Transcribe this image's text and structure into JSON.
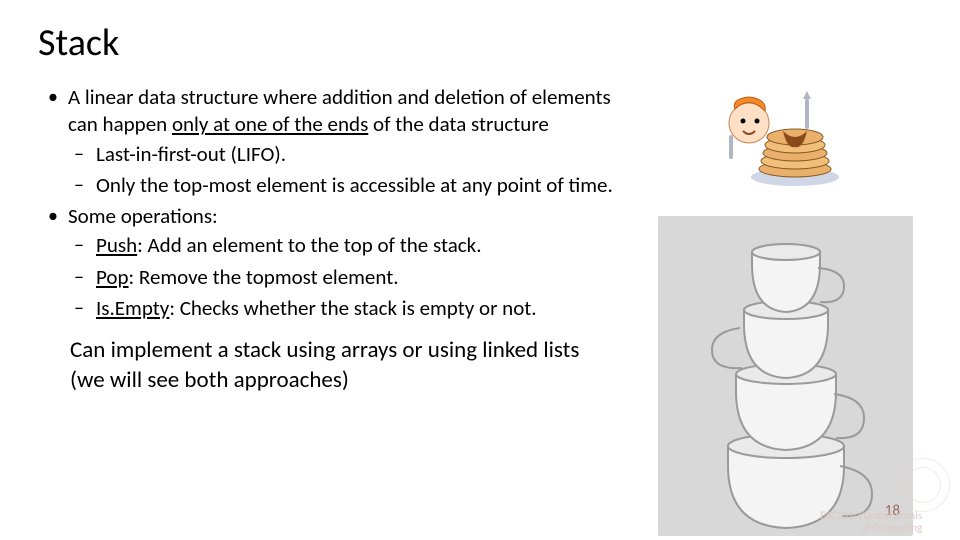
{
  "title": "Stack",
  "bullets": {
    "b1_pre": "A linear data structure where addition and deletion of elements can happen ",
    "b1_u": "only at one of the ends",
    "b1_post": " of the data structure",
    "b1s1": " Last-in-first-out (LIFO).",
    "b1s2": "Only the top-most element is accessible at any point of time.",
    "b2": "Some operations:",
    "b2s1_u": "Push",
    "b2s1_post": ": Add an element to the top of the stack.",
    "b2s2_u": "Pop",
    "b2s2_post": ": Remove the topmost element.",
    "b2s3_u": "Is.Empty",
    "b2s3_post": ": Checks whether the stack is empty or not."
  },
  "closing": "Can implement a stack using arrays or using linked lists (we will see both approaches)",
  "page_number": "18",
  "footer_line1": "ESC101: Fundamentals",
  "footer_line2": "of Computing",
  "images": {
    "top_right": "cartoon-eating-pancakes",
    "right": "grayscale-stacked-cups"
  }
}
